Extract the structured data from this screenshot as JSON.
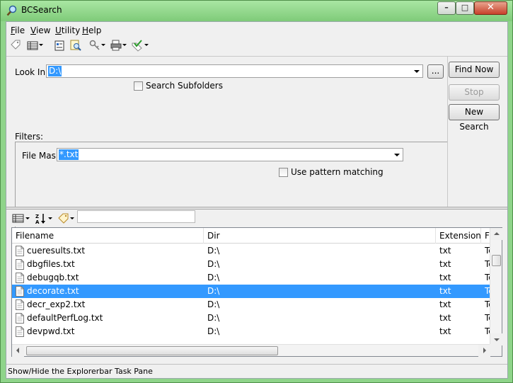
{
  "window": {
    "title": "BCSearch"
  },
  "menu": [
    {
      "label": "File",
      "u": "F",
      "rest": "ile"
    },
    {
      "label": "View",
      "u": "V",
      "rest": "iew"
    },
    {
      "label": "Utility",
      "u": "U",
      "rest": "tility"
    },
    {
      "label": "Help",
      "u": "H",
      "rest": "elp"
    }
  ],
  "search": {
    "look_in_label": "Look In:",
    "look_in_value": "D:\\",
    "browse_label": "...",
    "search_subfolders_label": "Search Subfolders",
    "filters_label": "Filters:",
    "file_mask_label": "File Mask:",
    "file_mask_value": "*.txt",
    "pattern_label": "Use pattern matching",
    "find_now": "Find Now",
    "stop": "Stop",
    "new_search": "New Search"
  },
  "results": {
    "columns": [
      "Filename",
      "Dir",
      "Extension",
      "Fil"
    ],
    "rows": [
      {
        "filename": "cueresults.txt",
        "dir": "D:\\",
        "ext": "txt",
        "type": "Te"
      },
      {
        "filename": "dbgfiles.txt",
        "dir": "D:\\",
        "ext": "txt",
        "type": "Te"
      },
      {
        "filename": "debugqb.txt",
        "dir": "D:\\",
        "ext": "txt",
        "type": "Te"
      },
      {
        "filename": "decorate.txt",
        "dir": "D:\\",
        "ext": "txt",
        "type": "Te",
        "selected": true
      },
      {
        "filename": "decr_exp2.txt",
        "dir": "D:\\",
        "ext": "txt",
        "type": "Te"
      },
      {
        "filename": "defaultPerfLog.txt",
        "dir": "D:\\",
        "ext": "txt",
        "type": "Te"
      },
      {
        "filename": "devpwd.txt",
        "dir": "D:\\",
        "ext": "txt",
        "type": "Te"
      }
    ]
  },
  "status": {
    "text": "Show/Hide the Explorerbar Task Pane"
  },
  "colors": {
    "selection": "#3399ff",
    "titlebar": "#8fd48a"
  }
}
